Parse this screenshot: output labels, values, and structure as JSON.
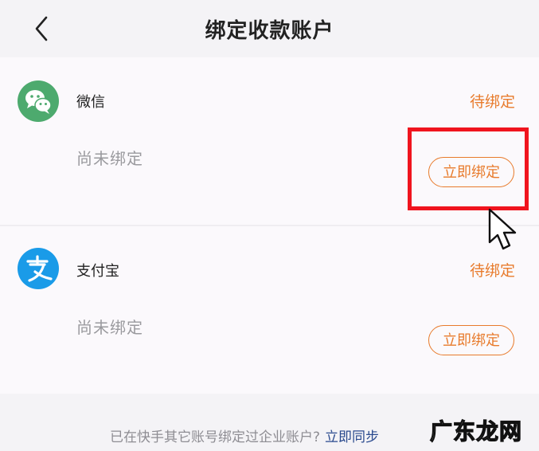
{
  "header": {
    "title": "绑定收款账户",
    "back_icon": "chevron-left-icon"
  },
  "accounts": [
    {
      "name": "微信",
      "status": "待绑定",
      "sub": "尚未绑定",
      "button": "立即绑定",
      "icon": "wechat-icon",
      "icon_color": "#4daa6e"
    },
    {
      "name": "支付宝",
      "status": "待绑定",
      "sub": "尚未绑定",
      "button": "立即绑定",
      "icon": "alipay-icon",
      "icon_color": "#1a9be8"
    }
  ],
  "bottom_hint": {
    "text": "已在快手其它账号绑定过企业账户?",
    "link": "立即同步",
    "link_icon": "chevron-right-icon"
  },
  "watermark": "广东龙网",
  "colors": {
    "accent": "#e87b2c",
    "highlight": "#f0141e",
    "link": "#2a4a8e"
  }
}
